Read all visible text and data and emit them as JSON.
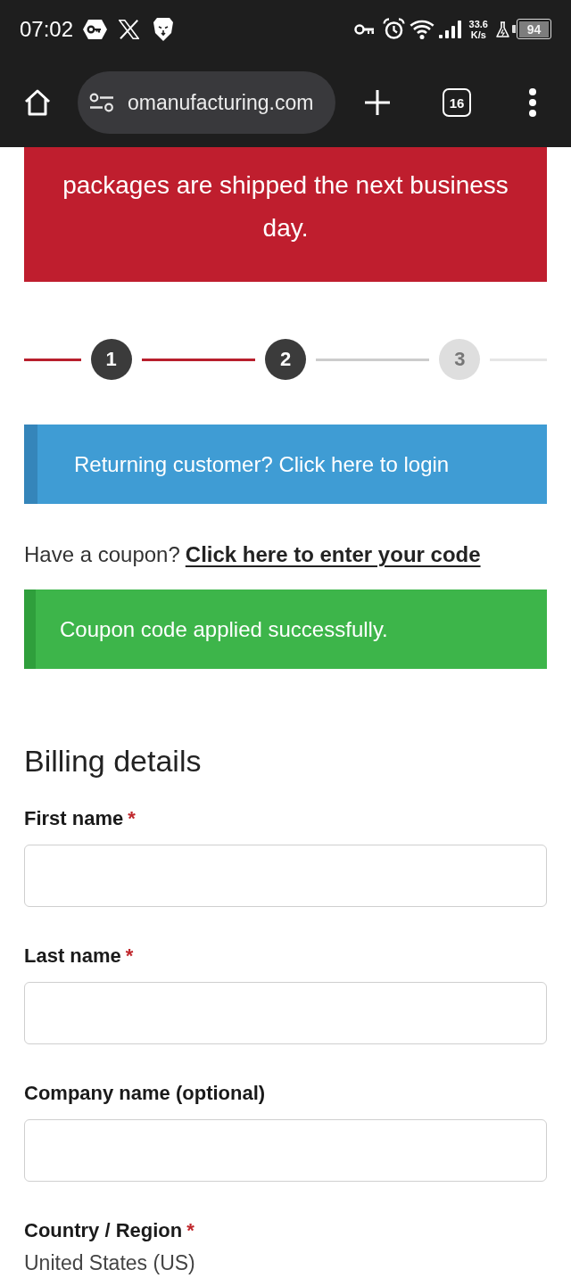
{
  "status_bar": {
    "time": "07:02",
    "network_speed": "33.6",
    "network_speed_unit": "K/s",
    "battery": "94"
  },
  "browser_toolbar": {
    "url": "omanufacturing.com",
    "tab_count": "16"
  },
  "shipping_banner": {
    "text": "packages are shipped the next business day."
  },
  "stepper": {
    "steps": [
      {
        "label": "1",
        "reached": true
      },
      {
        "label": "2",
        "reached": true
      },
      {
        "label": "3",
        "reached": false
      }
    ]
  },
  "login_notice": {
    "kind": "info",
    "text": "Returning customer? Click here to login"
  },
  "coupon_prompt": {
    "text": "Have a coupon?",
    "link": "Click here to enter your code"
  },
  "coupon_notice": {
    "kind": "success",
    "text": "Coupon code applied successfully."
  },
  "billing": {
    "heading": "Billing details",
    "fields": [
      {
        "kind": "text",
        "label": "First name",
        "required_mark": "*"
      },
      {
        "kind": "text",
        "label": "Last name",
        "required_mark": "*"
      },
      {
        "kind": "text",
        "label": "Company name (optional)"
      },
      {
        "kind": "select",
        "label": "Country / Region",
        "required_mark": "*",
        "value": "United States (US)"
      }
    ]
  }
}
